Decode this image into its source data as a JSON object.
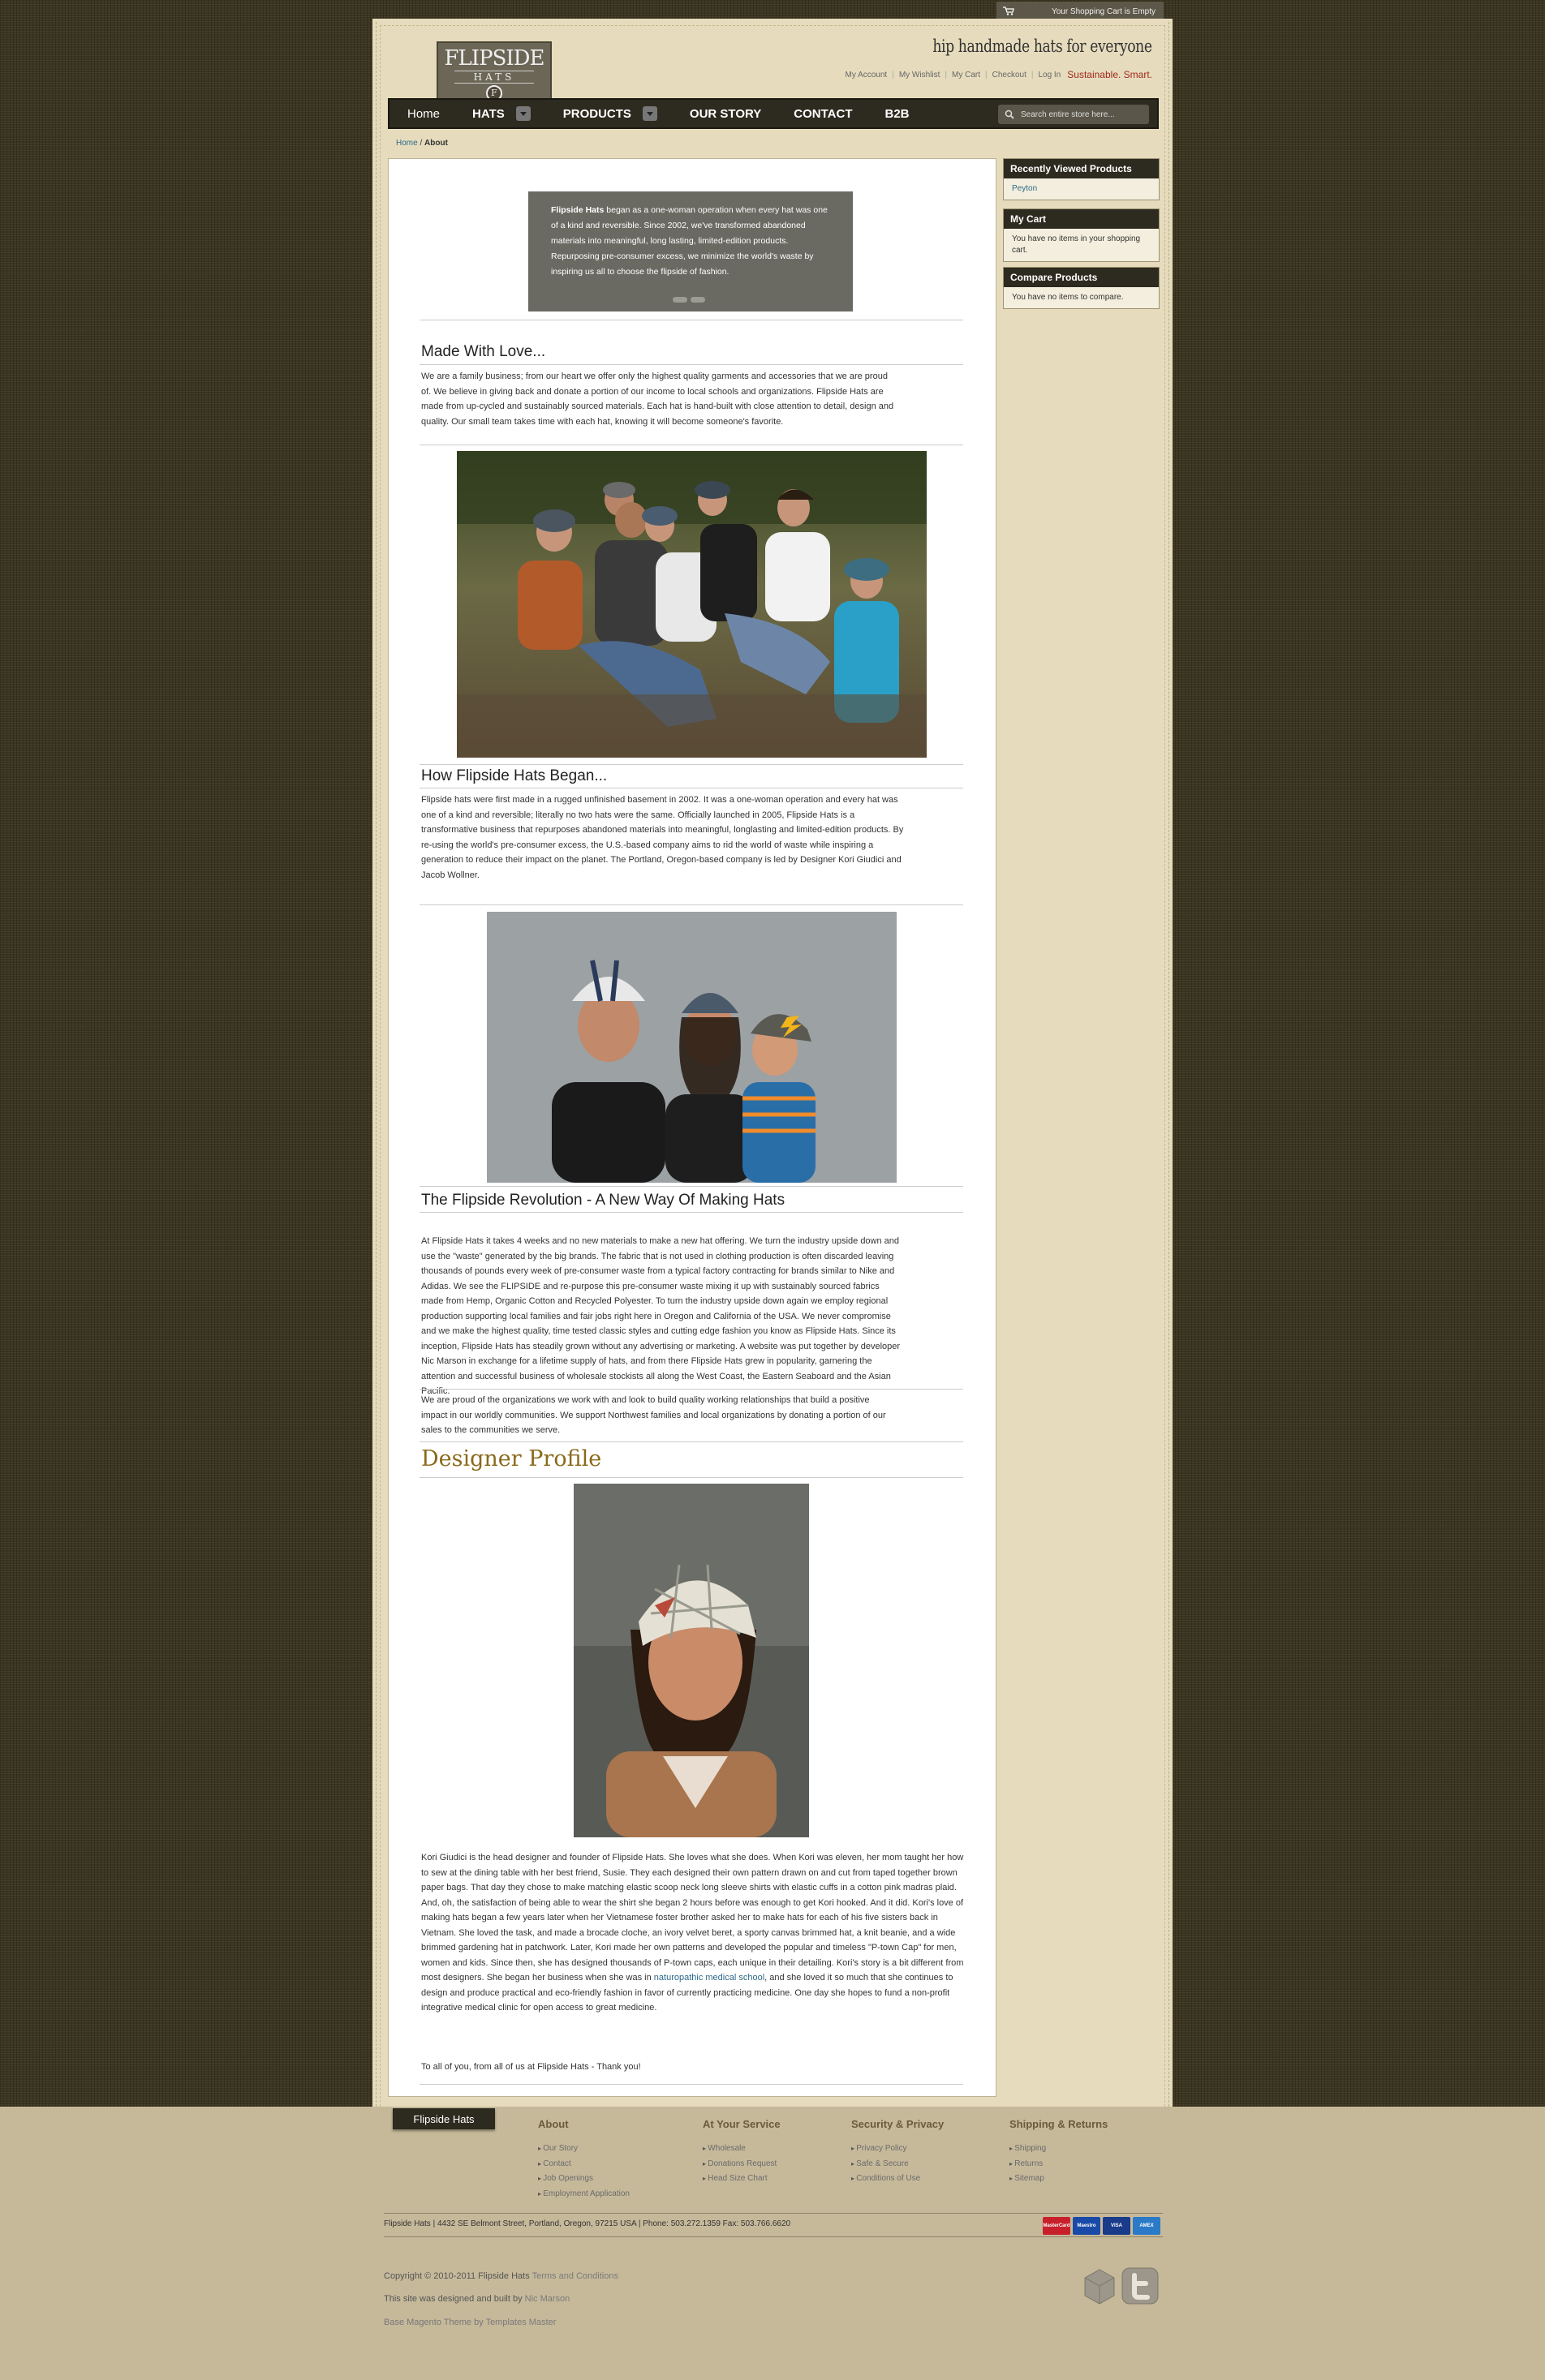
{
  "cart_bar": {
    "text": "Your Shopping Cart is Empty"
  },
  "header": {
    "logo_line1": "FLIPSIDE",
    "logo_line2": "HATS",
    "logo_mark": "F",
    "tagline": "hip handmade hats for everyone",
    "links": [
      "My Account",
      "My Wishlist",
      "My Cart",
      "Checkout",
      "Log In"
    ],
    "slogan": "Sustainable. Smart."
  },
  "nav": {
    "items": [
      {
        "label": "Home",
        "dropdown": false,
        "bold": false
      },
      {
        "label": "HATS",
        "dropdown": true,
        "bold": true
      },
      {
        "label": "PRODUCTS",
        "dropdown": true,
        "bold": true
      },
      {
        "label": "OUR STORY",
        "dropdown": false,
        "bold": true
      },
      {
        "label": "CONTACT",
        "dropdown": false,
        "bold": true
      },
      {
        "label": "B2B",
        "dropdown": false,
        "bold": true
      }
    ],
    "search_placeholder": "Search entire store here..."
  },
  "breadcrumb": {
    "home": "Home",
    "sep": " / ",
    "current": "About"
  },
  "intro": {
    "lead": "Flipside Hats",
    "text": " began as a one-woman operation when every hat was one of a kind and reversible. Since 2002, we've transformed abandoned materials into meaningful, long lasting, limited-edition products. Repurposing pre-consumer excess, we minimize the world's waste by inspiring us all to choose the flipside of fashion."
  },
  "sections": {
    "made_with_love": {
      "title": "Made With Love...",
      "body": "We are a family business;  from our heart we offer only the highest quality garments and accessories that we are proud of. We believe in giving back and donate a portion of our income to local schools and organizations. Flipside Hats are made from up-cycled and sustainably sourced materials. Each hat is hand-built with close attention to detail, design and quality. Our small team takes time with each hat, knowing it will become someone's favorite."
    },
    "how_began": {
      "title": "How Flipside Hats Began...",
      "body": "Flipside hats were first made in a rugged unfinished basement in 2002. It was a one-woman operation and every hat was one of a kind and reversible; literally no two hats were the same. Officially launched in 2005, Flipside Hats is a transformative business that repurposes abandoned materials into meaningful, longlasting and limited-edition products. By re-using the world's pre-consumer excess, the U.S.-based company aims to rid the world of waste while inspiring a generation to reduce their impact on the planet. The Portland, Oregon-based company is led by Designer Kori Giudici and Jacob Wollner."
    },
    "revolution": {
      "title": "The Flipside Revolution - A New Way Of Making Hats",
      "body": "At Flipside Hats it takes 4 weeks and no new materials to make a new hat offering. We turn the industry upside down and use the \"waste\" generated by the big brands. The fabric that is not used in clothing production is often discarded leaving thousands of pounds every week of pre-consumer waste from a typical factory contracting for brands similar to Nike and Adidas. We see the FLIPSIDE and re-purpose this pre-consumer waste mixing it up with sustainably sourced fabrics made from Hemp, Organic Cotton and Recycled Polyester. To turn the industry upside down again we employ regional production supporting local families and fair jobs right here in Oregon and California of the USA. We never compromise and we make the highest quality, time tested classic styles and cutting edge fashion you know as Flipside Hats. Since its inception, Flipside Hats has steadily grown without any advertising or marketing. A website was put together by developer Nic Marson in exchange for a lifetime supply of hats, and from there Flipside Hats grew in popularity, garnering the attention and successful business of wholesale stockists all along the West Coast, the Eastern Seaboard and the Asian Pacific.",
      "body2": "We are proud of the organizations we work with and look to build quality working relationships that build a positive impact in our worldly communities. We support Northwest families and local organizations by donating a portion of our sales to the communities we serve."
    },
    "designer": {
      "title": "Designer Profile",
      "body_a": "Kori Giudici is the head designer and founder of Flipside Hats.  She loves what she does. When Kori was eleven, her mom taught her how to sew at the dining table with her best friend, Susie.  They each designed their own pattern drawn on and cut from taped together brown paper bags.  That day they chose to make matching elastic scoop neck long sleeve shirts with elastic cuffs in a cotton pink madras plaid.  And, oh, the satisfaction of being able to wear the shirt she began 2 hours before was enough to get Kori hooked.  And it did. Kori's love of making hats began a few years later when her Vietnamese foster brother asked her to make hats for each of his five sisters back in Vietnam.  She loved the task, and made a brocade cloche, an ivory velvet beret, a sporty canvas brimmed hat, a knit beanie, and a wide brimmed gardening hat in patchwork.  Later, Kori made her own patterns and developed the popular and timeless \"P-town Cap\" for men, women and kids.  Since then, she has designed thousands of P-town caps, each unique in their detailing. Kori's story is a bit different from most designers.  She began her business when she was in ",
      "link": "naturopathic medical school",
      "body_b": ", and she loved it so much that she continues to design and produce practical and eco-friendly fashion in favor of currently practicing medicine.   One day she hopes to fund a non-profit integrative medical clinic for open access to great medicine.",
      "closing": "To all of you, from all of us at Flipside Hats - Thank you!"
    }
  },
  "sidebar": {
    "recent": {
      "title": "Recently Viewed Products",
      "item": "Peyton"
    },
    "cart": {
      "title": "My Cart",
      "text": "You have no items in your shopping cart."
    },
    "compare": {
      "title": "Compare Products",
      "text": "You have no items to compare."
    }
  },
  "footer": {
    "tab": "Flipside Hats",
    "columns": [
      {
        "title": "About",
        "links": [
          "Our Story",
          "Contact",
          "Job Openings",
          "Employment Application"
        ]
      },
      {
        "title": "At Your Service",
        "links": [
          "Wholesale",
          "Donations Request",
          "Head Size Chart"
        ]
      },
      {
        "title": "Security & Privacy",
        "links": [
          "Privacy Policy",
          "Safe & Secure",
          "Conditions of Use"
        ]
      },
      {
        "title": "Shipping & Returns",
        "links": [
          "Shipping",
          "Returns",
          "Sitemap"
        ]
      }
    ],
    "address": "Flipside Hats | 4432 SE Belmont Street, Portland, Oregon, 97215 USA | Phone: 503.272.1359 Fax: 503.766.6620",
    "cards": [
      "MasterCard",
      "Maestro",
      "VISA",
      "AMEX"
    ],
    "copyright": "Copyright © 2010-2011 Flipside Hats",
    "terms": "Terms and Conditions",
    "designed": "This site was designed and built by",
    "designer_link": "Nic Marson",
    "theme_prefix": "Base Magento Theme by",
    "theme_link": "Templates Master"
  },
  "colors": {
    "nav_bg": "#2d2a1f",
    "page_bg": "#e6dcbd",
    "link": "#2d6a8a",
    "accent_red": "#a0281c",
    "designer_heading": "#8a6a1a"
  }
}
